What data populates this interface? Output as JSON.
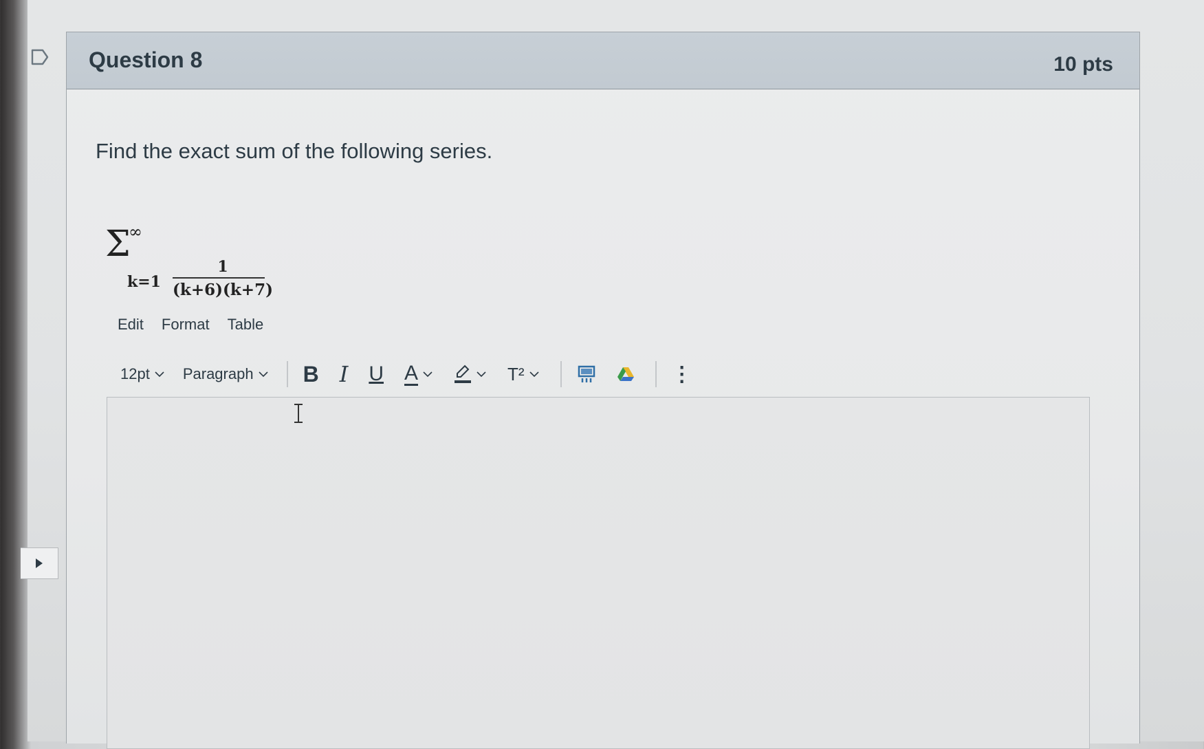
{
  "question": {
    "title": "Question 8",
    "points": "10 pts",
    "prompt": "Find the exact sum of the following series.",
    "series": {
      "sigma": "Σ",
      "upper": "∞",
      "lower": "k=1",
      "numerator": "1",
      "denominator": "(k+6)(k+7)"
    }
  },
  "editor": {
    "menu": [
      "Edit",
      "Format",
      "Table"
    ],
    "font_size": "12pt",
    "block_format": "Paragraph",
    "bold_label": "B",
    "italic_label": "I",
    "underline_label": "U",
    "text_color_label": "A",
    "superscript_label": "T²",
    "more_label": "⋮",
    "content": ""
  },
  "colors": {
    "header_bg": "#c4ccd3",
    "text": "#2d3b45",
    "link_icon": "#2f6fa6",
    "drive_icon_green": "#3a9b4a",
    "drive_icon_yellow": "#e9b62c",
    "drive_icon_blue": "#3b73c8"
  },
  "icons": {
    "flag": "flag-icon",
    "side_arrow": "play-arrow-icon",
    "highlight": "highlighter-icon",
    "embed": "embed-icon",
    "drive": "google-drive-icon",
    "cursor": "i-beam-cursor-icon"
  }
}
